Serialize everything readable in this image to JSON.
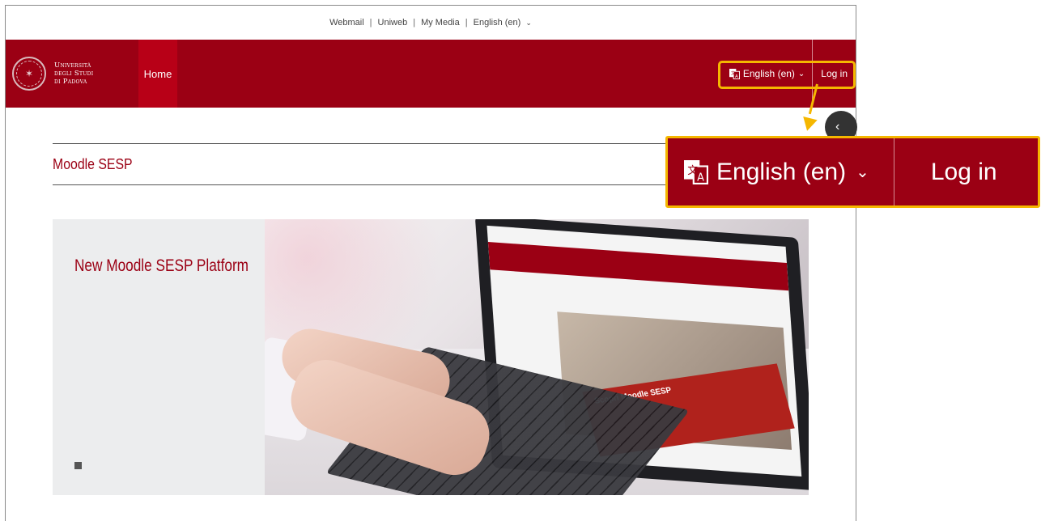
{
  "util_bar": {
    "links": [
      "Webmail",
      "Uniweb",
      "My Media"
    ],
    "language": "English (en)"
  },
  "brand": {
    "line1": "Università",
    "line2": "degli Studi",
    "line3": "di Padova"
  },
  "navbar": {
    "home": "Home",
    "language": "English (en)",
    "login": "Log in"
  },
  "page": {
    "title": "Moodle SESP"
  },
  "carousel": {
    "caption": "New Moodle SESP Platform",
    "screen_banner": "Scopri Moodle SESP"
  },
  "callout": {
    "language": "English (en)",
    "login": "Log in"
  },
  "colors": {
    "brand_red": "#9b0014",
    "highlight": "#f5b700"
  }
}
